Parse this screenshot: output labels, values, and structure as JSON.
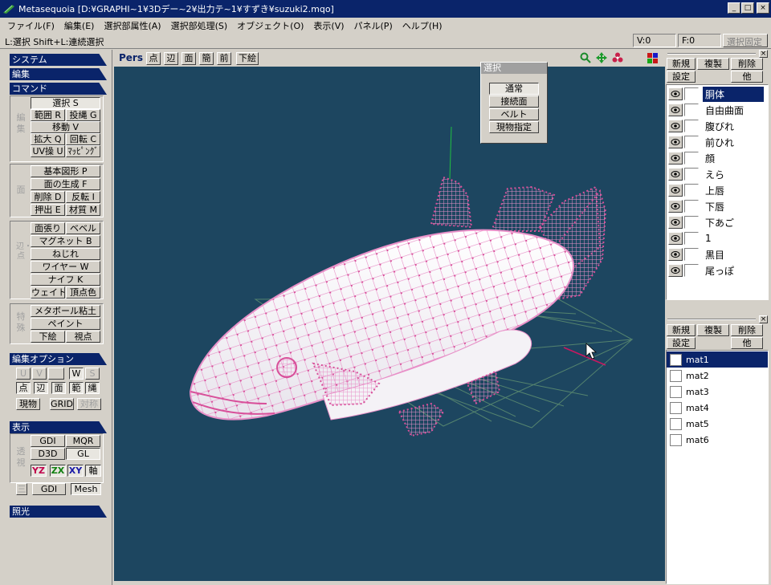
{
  "window": {
    "title": "Metasequoia [D:¥GRAPHI~1¥3Dデー~2¥出力テ~1¥すずき¥suzuki2.mqo]",
    "minimize": "_",
    "maximize": "□",
    "close": "×"
  },
  "menu": [
    "ファイル(F)",
    "編集(E)",
    "選択部属性(A)",
    "選択部処理(S)",
    "オブジェクト(O)",
    "表示(V)",
    "パネル(P)",
    "ヘルプ(H)"
  ],
  "status": {
    "hint": "L:選択  Shift+L:連続選択",
    "vertex_count": "V:0",
    "face_count": "F:0",
    "select_lock": "選択固定"
  },
  "left": {
    "system": "システム",
    "edit": "編集",
    "command": "コマンド",
    "grp1_label": "編集",
    "select": "選択 S",
    "range": "範囲 R",
    "lasso": "投縄 G",
    "move": "移動 V",
    "scale": "拡大 Q",
    "rotate": "回転 C",
    "uv": "UV操 U",
    "mapping": "ﾏｯﾋﾟﾝｸﾞ",
    "grp2_label": "面",
    "primitive": "基本図形 P",
    "face_gen": "面の生成 F",
    "delete": "削除 D",
    "invert": "反転 I",
    "extrude": "押出 E",
    "material": "材質 M",
    "grp3_label": "辺・点",
    "face_stretch": "面張り",
    "bevel": "ベベル",
    "magnet": "マグネット B",
    "twist": "ねじれ",
    "wire": "ワイヤー W",
    "knife": "ナイフ K",
    "weight": "ウェイト",
    "vertex_color": "頂点色",
    "grp4_label": "特殊",
    "metaball": "メタボール粘土",
    "paint": "ペイント",
    "underlay": "下絵",
    "viewpoint": "視点",
    "edit_options": "編集オプション",
    "opt_u": "U",
    "opt_v": "V",
    "opt_w": "W",
    "opt_s": "S",
    "opt_point": "点",
    "opt_edge": "辺",
    "opt_face": "面",
    "opt_range": "範",
    "opt_lasso": "縄",
    "opt_current": "現物",
    "opt_grid": "GRID",
    "opt_sym": "対称",
    "display": "表示",
    "grp5_label": "透視",
    "gdi": "GDI",
    "mqr": "MQR",
    "d3d": "D3D",
    "gl": "GL",
    "yz": "YZ",
    "zx": "ZX",
    "xy": "XY",
    "axis": "軸",
    "grp6_label": "三",
    "gdi2": "GDI",
    "mesh": "Mesh",
    "lighting": "照光"
  },
  "viewbar": {
    "pers": "Pers",
    "point": "点",
    "edge": "辺",
    "face": "面",
    "simple": "簡",
    "front": "前",
    "underlay": "下絵"
  },
  "select_panel": {
    "title": "選択",
    "normal": "通常",
    "connected": "接続面",
    "belt": "ベルト",
    "current": "現物指定"
  },
  "objects": {
    "new": "新規",
    "duplicate": "複製",
    "delete": "削除",
    "settings": "設定",
    "other": "他",
    "items": [
      "胴体",
      "自由曲面",
      "腹びれ",
      "前ひれ",
      "顔",
      "えら",
      "上唇",
      "下唇",
      "下あご",
      "1",
      "黒目",
      "尾っぽ"
    ]
  },
  "materials": {
    "new": "新規",
    "duplicate": "複製",
    "delete": "削除",
    "settings": "設定",
    "other": "他",
    "items": [
      "mat1",
      "mat2",
      "mat3",
      "mat4",
      "mat5",
      "mat6"
    ]
  },
  "colors": {
    "accent": "#0a246a",
    "viewport_bg": "#1d4660",
    "wire": "#e890c8",
    "grid": "#5a8a70"
  }
}
